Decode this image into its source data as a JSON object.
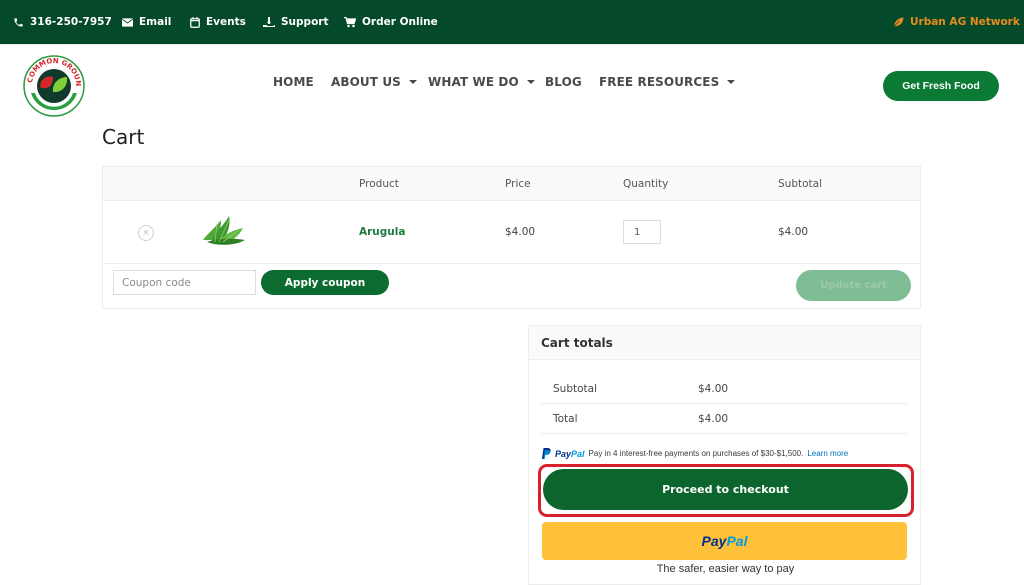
{
  "topbar": {
    "phone": "316-250-7957",
    "email": "Email",
    "events": "Events",
    "support": "Support",
    "order_online": "Order Online",
    "network": "Urban AG Network",
    "icons": [
      "phone-icon",
      "envelope-icon",
      "calendar-icon",
      "hand-donate-icon",
      "cart-icon",
      "leaf-icon"
    ]
  },
  "header": {
    "logo_text": "COMMON GROUND",
    "nav": [
      {
        "label": "HOME",
        "dropdown": false
      },
      {
        "label": "ABOUT US",
        "dropdown": true
      },
      {
        "label": "WHAT WE DO",
        "dropdown": true
      },
      {
        "label": "BLOG",
        "dropdown": false
      },
      {
        "label": "FREE RESOURCES",
        "dropdown": true
      }
    ],
    "cta": "Get Fresh Food"
  },
  "page": {
    "title": "Cart"
  },
  "cart": {
    "columns": [
      "",
      "",
      "Product",
      "Price",
      "Quantity",
      "Subtotal"
    ],
    "items": [
      {
        "name": "Arugula",
        "price": "$4.00",
        "quantity": "1",
        "subtotal": "$4.00"
      }
    ],
    "coupon_placeholder": "Coupon code",
    "apply_coupon": "Apply coupon",
    "update_cart": "Update cart",
    "remove_glyph": "×"
  },
  "totals": {
    "title": "Cart totals",
    "rows": [
      {
        "label": "Subtotal",
        "value": "$4.00"
      },
      {
        "label": "Total",
        "value": "$4.00"
      }
    ],
    "paypal_message": "Pay in 4 interest-free payments on purchases of $30-$1,500.",
    "paypal_learn_more": "Learn more",
    "paypal_brand_1": "Pay",
    "paypal_brand_2": "Pal",
    "checkout": "Proceed to checkout",
    "paypal_tagline": "The safer, easier way to pay"
  },
  "colors": {
    "topbar_bg": "#044a2a",
    "brand_green": "#0b7a35",
    "checkout_green": "#0b652c",
    "network_orange": "#e98b1f",
    "highlight_red": "#d7222c",
    "paypal_yellow": "#ffc13a"
  }
}
